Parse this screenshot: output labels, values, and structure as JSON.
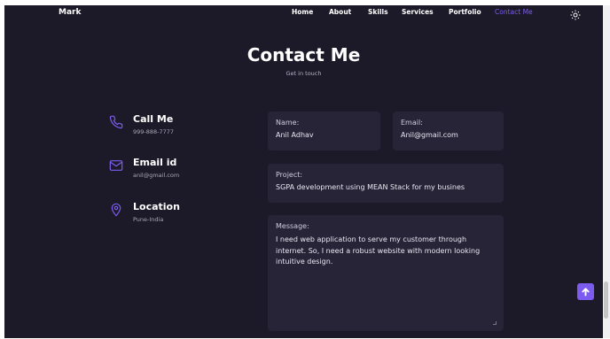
{
  "header": {
    "brand": "Mark",
    "nav": [
      "Home",
      "About",
      "Skills",
      "Services",
      "Portfolio",
      "Contact Me"
    ],
    "active_nav": "Contact Me"
  },
  "section": {
    "title": "Contact Me",
    "subtitle": "Get in touch"
  },
  "contact_info": [
    {
      "icon": "phone-icon",
      "heading": "Call Me",
      "detail": "999-888-7777"
    },
    {
      "icon": "mail-icon",
      "heading": "Email id",
      "detail": "anil@gmail.com"
    },
    {
      "icon": "location-icon",
      "heading": "Location",
      "detail": "Pune-India"
    }
  ],
  "form": {
    "name": {
      "label": "Name:",
      "value": "Anil Adhav"
    },
    "email": {
      "label": "Email:",
      "value": "Anil@gmail.com"
    },
    "project": {
      "label": "Project:",
      "value": "SGPA development using MEAN Stack for my busines"
    },
    "message": {
      "label": "Message:",
      "value": "I need web application to serve my customer through internet. So, I need a robust website with modern looking intuitive design."
    }
  },
  "colors": {
    "background": "#1c1a28",
    "field": "#272438",
    "accent": "#7c5cf0",
    "text": "#ffffff"
  },
  "icons": {
    "theme_toggle": "sun-icon",
    "scroll_top": "arrow-up-icon"
  }
}
